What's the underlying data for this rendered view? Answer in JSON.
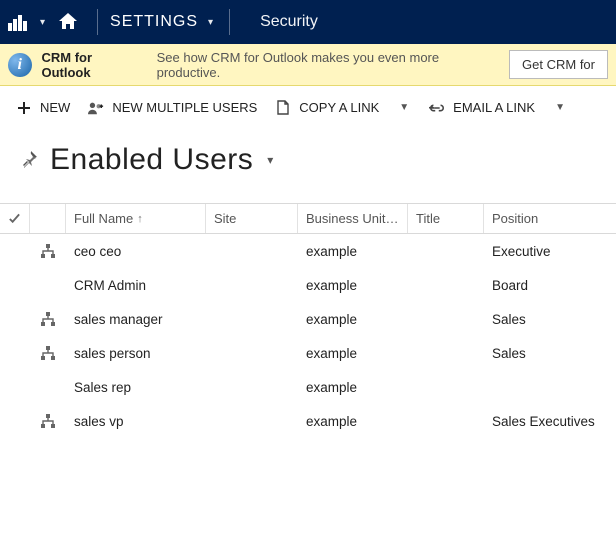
{
  "nav": {
    "settings_label": "SETTINGS",
    "breadcrumb": "Security"
  },
  "banner": {
    "title": "CRM for Outlook",
    "text": "See how CRM for Outlook makes you even more productive.",
    "button": "Get CRM for"
  },
  "commands": {
    "new": "NEW",
    "new_multi": "NEW MULTIPLE USERS",
    "copy_link": "COPY A LINK",
    "email_link": "EMAIL A LINK"
  },
  "view": {
    "title": "Enabled Users"
  },
  "grid": {
    "columns": {
      "full_name": "Full Name",
      "site": "Site",
      "business_unit": "Business Unit…",
      "title": "Title",
      "position": "Position"
    },
    "rows": [
      {
        "has_icon": true,
        "full_name": "ceo ceo",
        "site": "",
        "bu": "example",
        "title": "",
        "position": "Executive"
      },
      {
        "has_icon": false,
        "full_name": "CRM Admin",
        "site": "",
        "bu": "example",
        "title": "",
        "position": "Board"
      },
      {
        "has_icon": true,
        "full_name": "sales manager",
        "site": "",
        "bu": "example",
        "title": "",
        "position": "Sales"
      },
      {
        "has_icon": true,
        "full_name": "sales person",
        "site": "",
        "bu": "example",
        "title": "",
        "position": "Sales"
      },
      {
        "has_icon": false,
        "full_name": "Sales rep",
        "site": "",
        "bu": "example",
        "title": "",
        "position": ""
      },
      {
        "has_icon": true,
        "full_name": "sales vp",
        "site": "",
        "bu": "example",
        "title": "",
        "position": "Sales Executives"
      }
    ]
  }
}
